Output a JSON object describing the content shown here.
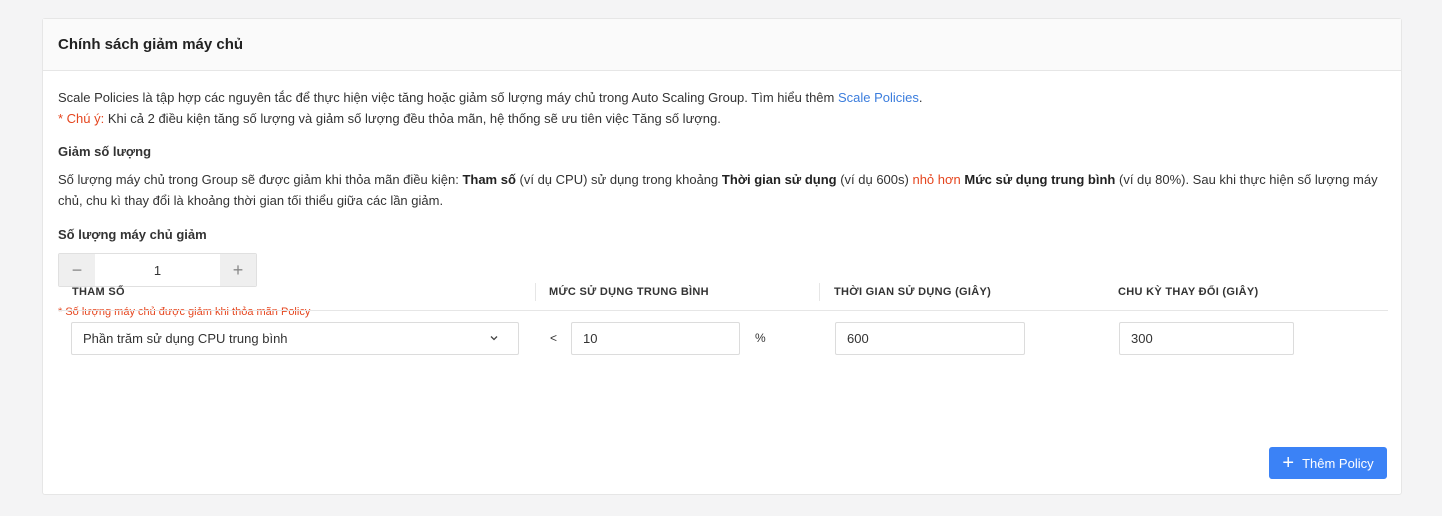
{
  "title": "Chính sách giảm máy chủ",
  "intro": {
    "text": "Scale Policies là tập hợp các nguyên tắc để thực hiện việc tăng hoặc giảm số lượng máy chủ trong Auto Scaling Group. Tìm hiểu thêm ",
    "link": "Scale Policies",
    "end": "."
  },
  "warning": {
    "label": "* Chú ý:",
    "text": " Khi cả 2 điều kiện tăng số lượng và giảm số lượng đều thỏa mãn, hệ thống sẽ ưu tiên việc Tăng số lượng."
  },
  "section": {
    "title": "Giảm số lượng",
    "desc": {
      "p1": "Số lượng máy chủ trong Group sẽ được giảm khi thỏa mãn điều kiện: ",
      "b1": "Tham số",
      "p2": " (ví dụ CPU) sử dụng trong khoảng ",
      "b2": "Thời gian sử dụng",
      "p3": " (ví dụ 600s) ",
      "red": "nhỏ hơn",
      "p4": " ",
      "b3": "Mức sử dụng trung bình",
      "p5": " (ví dụ 80%). Sau khi thực hiện số lượng máy chủ, chu kì thay đổi là khoảng thời gian tối thiểu giữa các lần giảm."
    }
  },
  "quantity": {
    "label": "Số lượng máy chủ giảm",
    "value": "1",
    "minus": "−",
    "plus": "+"
  },
  "note": "* Số lượng máy chủ được giảm khi thỏa mãn Policy",
  "table": {
    "headers": [
      "THAM SỐ",
      "MỨC SỬ DỤNG TRUNG BÌNH",
      "THỜI GIAN SỬ DỤNG (GIÂY)",
      "CHU KỲ THAY ĐỔI (GIÂY)"
    ],
    "row": {
      "param": "Phần trăm sử dụng CPU trung bình",
      "operator": "<",
      "avg": "10",
      "unit": "%",
      "duration": "600",
      "cooldown": "300"
    }
  },
  "add_button": "Thêm Policy",
  "colors": {
    "accent": "#3b82f6",
    "link": "#3b7ddd",
    "warning": "#e5461f"
  }
}
